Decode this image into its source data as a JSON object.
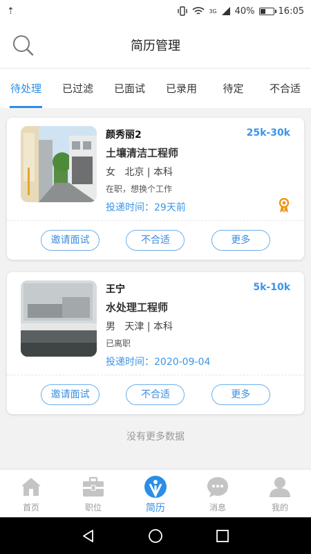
{
  "status_bar": {
    "usb": "⇡",
    "signal_label": "3G",
    "battery": "40%",
    "battery_level": 0.4,
    "time": "16:05"
  },
  "header": {
    "title": "简历管理",
    "search_icon": "search-icon"
  },
  "tabs": [
    {
      "label": "待处理",
      "active": true
    },
    {
      "label": "已过滤"
    },
    {
      "label": "已面试"
    },
    {
      "label": "已录用"
    },
    {
      "label": "待定"
    },
    {
      "label": "不合适"
    }
  ],
  "cards": [
    {
      "name": "颜秀丽2",
      "salary": "25k-30k",
      "position": "土壤清洁工程师",
      "gender": "女",
      "city_edu": "北京 | 本科",
      "status": "在职，想换个工作",
      "delivery": "投递时间：29天前",
      "has_badge": true,
      "buttons": [
        "邀请面试",
        "不合适",
        "更多"
      ]
    },
    {
      "name": "王宁",
      "salary": "5k-10k",
      "position": "水处理工程师",
      "gender": "男",
      "city_edu": "天津 | 本科",
      "status": "已离职",
      "delivery": "投递时间：2020-09-04",
      "has_badge": false,
      "buttons": [
        "邀请面试",
        "不合适",
        "更多"
      ]
    }
  ],
  "no_more": "没有更多数据",
  "tabbar": [
    {
      "label": "首页",
      "icon": "home-icon"
    },
    {
      "label": "职位",
      "icon": "briefcase-icon"
    },
    {
      "label": "简历",
      "icon": "resume-icon",
      "active": true
    },
    {
      "label": "消息",
      "icon": "message-icon"
    },
    {
      "label": "我的",
      "icon": "profile-icon"
    }
  ],
  "colors": {
    "accent": "#2a8ee8",
    "salary": "#3a95e8",
    "badge": "#f0960f"
  }
}
